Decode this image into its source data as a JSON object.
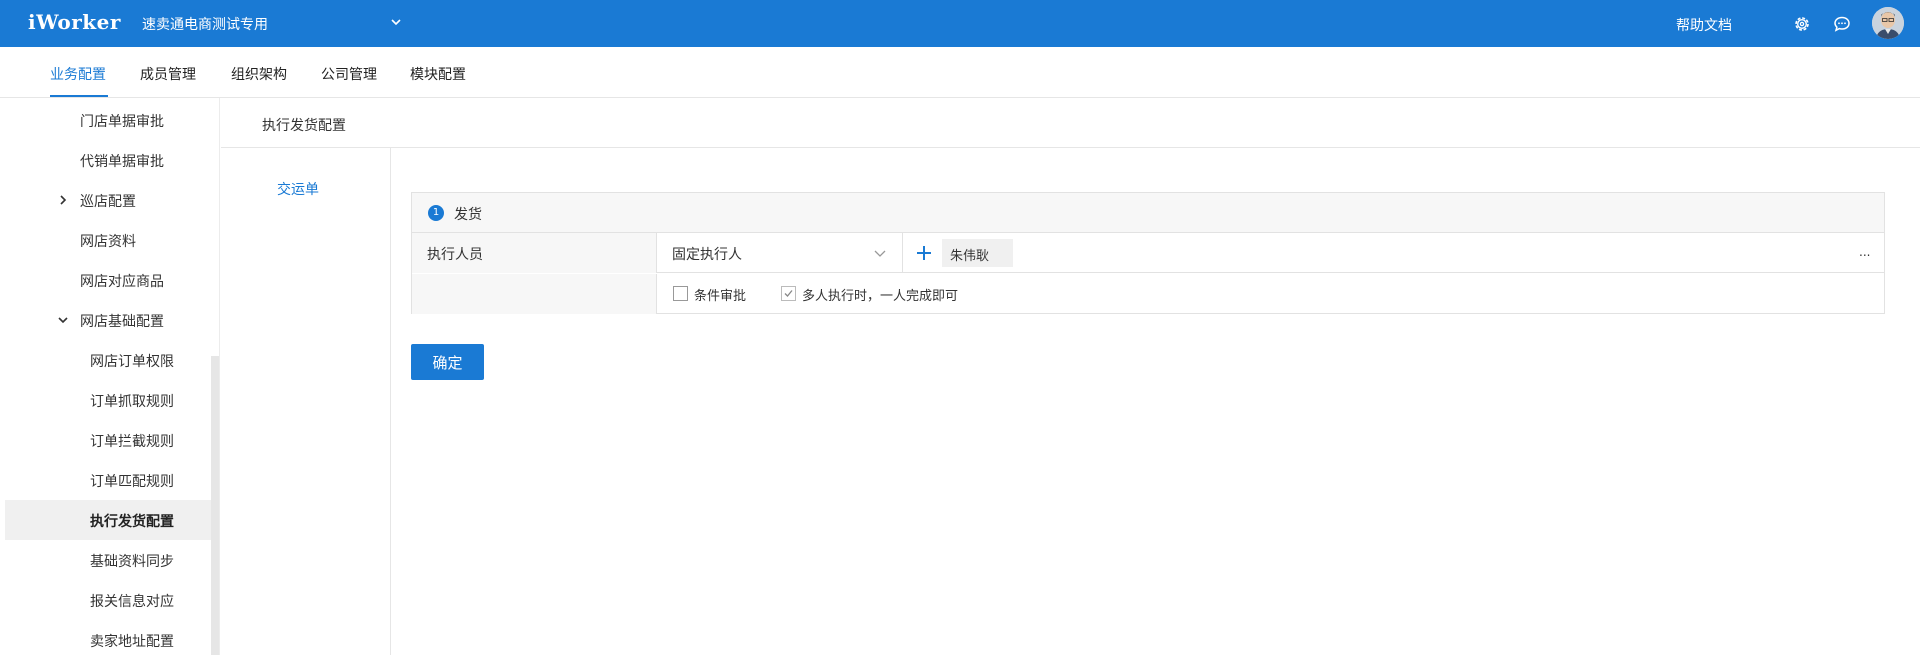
{
  "header": {
    "logo": "iWorker",
    "company": "速卖通电商测试专用",
    "help": "帮助文档",
    "colors": {
      "primary": "#1a7ad4"
    },
    "icons": [
      "chevron-down-icon",
      "gear-icon",
      "chat-icon",
      "avatar"
    ]
  },
  "nav": {
    "items": [
      {
        "label": "业务配置"
      },
      {
        "label": "成员管理"
      },
      {
        "label": "组织架构"
      },
      {
        "label": "公司管理"
      },
      {
        "label": "模块配置"
      }
    ],
    "active": "业务配置"
  },
  "sidebar": {
    "items": [
      {
        "label": "门店单据审批"
      },
      {
        "label": "代销单据审批"
      },
      {
        "label": "巡店配置"
      },
      {
        "label": "网店资料"
      },
      {
        "label": "网店对应商品"
      },
      {
        "label": "网店基础配置"
      },
      {
        "label": "网店订单权限"
      },
      {
        "label": "订单抓取规则"
      },
      {
        "label": "订单拦截规则"
      },
      {
        "label": "订单匹配规则"
      },
      {
        "label": "执行发货配置"
      },
      {
        "label": "基础资料同步"
      },
      {
        "label": "报关信息对应"
      },
      {
        "label": "卖家地址配置"
      }
    ],
    "active": "执行发货配置"
  },
  "breadcrumb": "执行发货配置",
  "subnav": {
    "label": "交运单"
  },
  "panel": {
    "step": "1",
    "title": "发货",
    "row1": {
      "label": "执行人员",
      "select": "固定执行人",
      "tag": "朱伟耿",
      "more": "..."
    },
    "row2": {
      "checkbox1": "条件审批",
      "checkbox2": "多人执行时，一人完成即可",
      "checkbox1_checked": false,
      "checkbox2_checked": true
    }
  },
  "confirm": "确定"
}
